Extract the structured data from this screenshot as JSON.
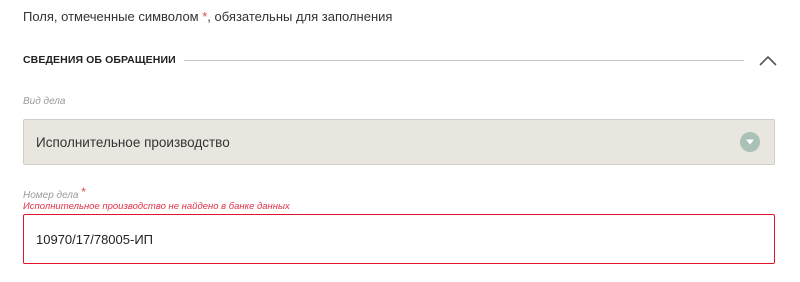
{
  "required_note": {
    "before": "Поля, отмеченные символом ",
    "star": "*",
    "after": ", обязательны для заполнения"
  },
  "section": {
    "title": "СВЕДЕНИЯ ОБ ОБРАЩЕНИИ",
    "collapse_icon": "chevron-up-icon",
    "line_color": "#c8c8c8"
  },
  "case_type": {
    "label": "Вид дела",
    "selected_value": "Исполнительное производство",
    "dropdown_icon": "chevron-down-icon",
    "background_color": "#e8e6df",
    "arrow_color": "#a9c1b6"
  },
  "case_number": {
    "label": "Номер дела",
    "required_star": "*",
    "error_message": "Исполнительное производство не найдено в банке данных",
    "value": "10970/17/78005-ИП",
    "error_color": "#e0142c"
  },
  "colors": {
    "required_star": "#e74c3c",
    "label_text": "#9a9a9a"
  }
}
